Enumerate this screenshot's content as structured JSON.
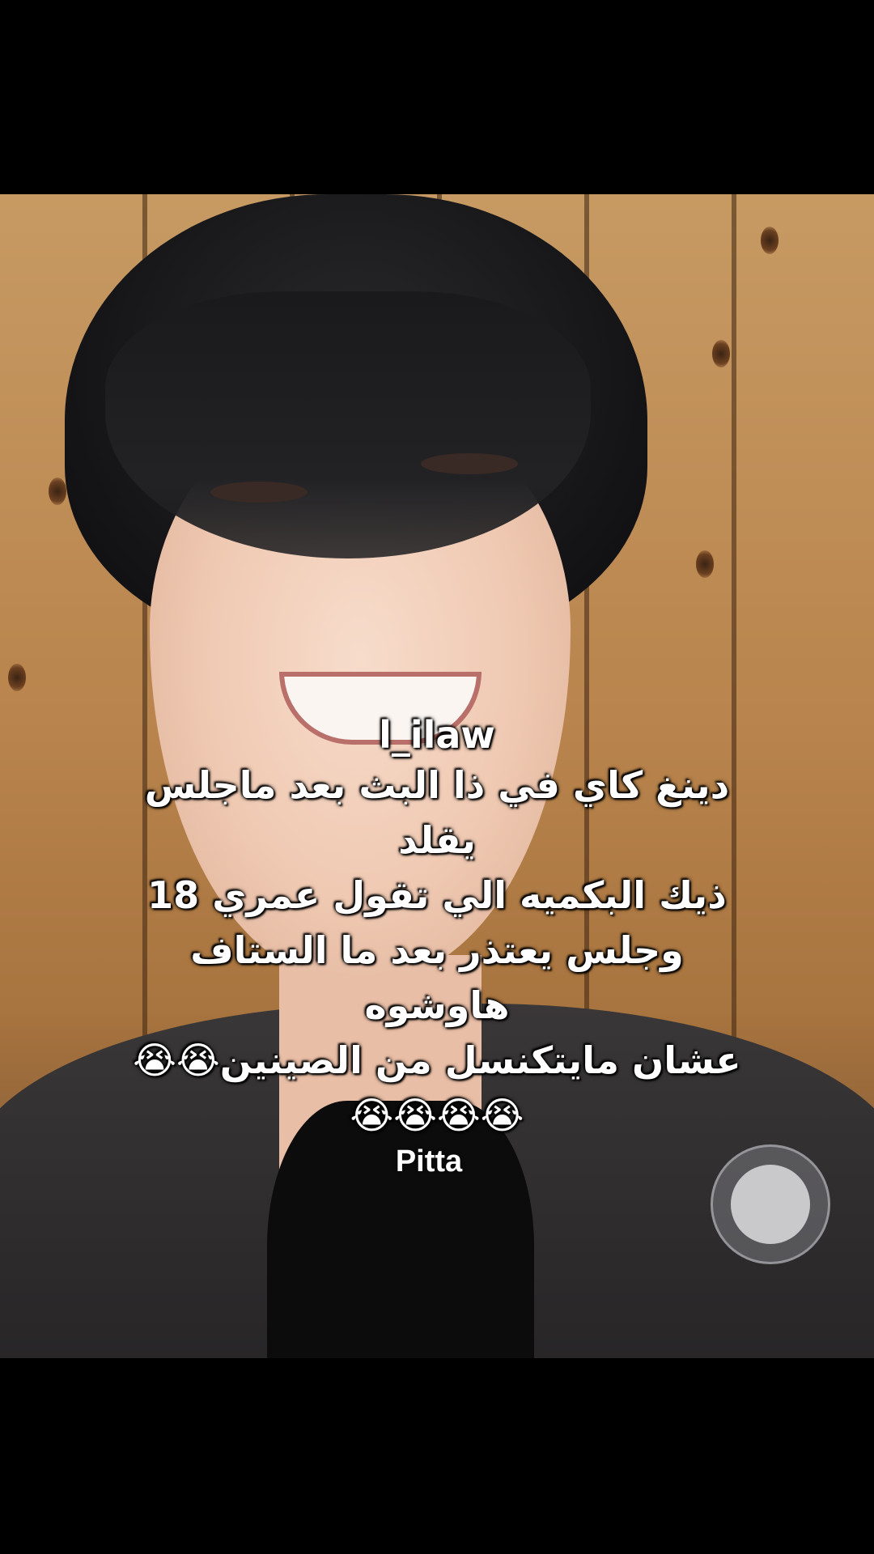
{
  "caption": {
    "username": "l_ilaw",
    "text": "دينغ كاي في ذا البث بعد ماجلس يقلد\nذيك البكميه الي تقول عمري 18\nوجلس يعتذر بعد ما الستاف هاوشوه\nعشان مايتكنسل من الصينين😭😭",
    "emoji_line": "😭😭😭😭"
  },
  "overlay": {
    "name_label": "Pitta"
  },
  "colors": {
    "background": "#000000",
    "caption_text": "#ffffff",
    "record_button": "#c9c9cc"
  }
}
